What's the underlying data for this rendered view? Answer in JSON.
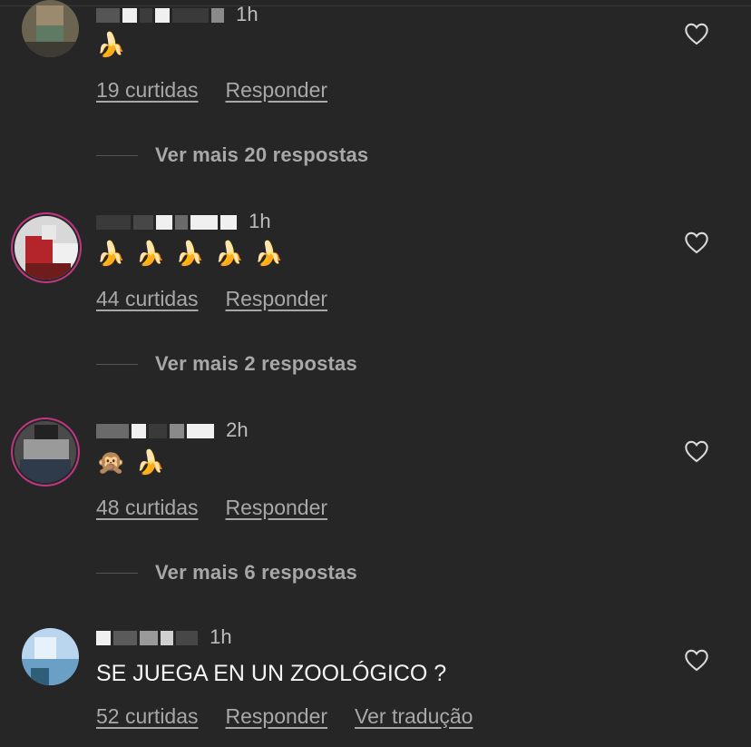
{
  "comments": [
    {
      "time": "1h",
      "text": "🍌",
      "likes": "19 curtidas",
      "reply": "Responder",
      "more_replies": "Ver mais 20 respostas"
    },
    {
      "time": "1h",
      "text": "🍌 🍌 🍌 🍌 🍌",
      "likes": "44 curtidas",
      "reply": "Responder",
      "more_replies": "Ver mais 2 respostas"
    },
    {
      "time": "2h",
      "text": "🙊 🍌",
      "likes": "48 curtidas",
      "reply": "Responder",
      "more_replies": "Ver mais 6 respostas"
    },
    {
      "time": "1h",
      "text": "SE JUEGA EN UN ZOOLÓGICO ?",
      "likes": "52 curtidas",
      "reply": "Responder",
      "translate": "Ver tradução"
    }
  ],
  "icons": {
    "like": "heart-outline-icon"
  },
  "colors": {
    "background": "#262626",
    "secondary_text": "#a8a8a8",
    "story_ring": "#c13584"
  }
}
